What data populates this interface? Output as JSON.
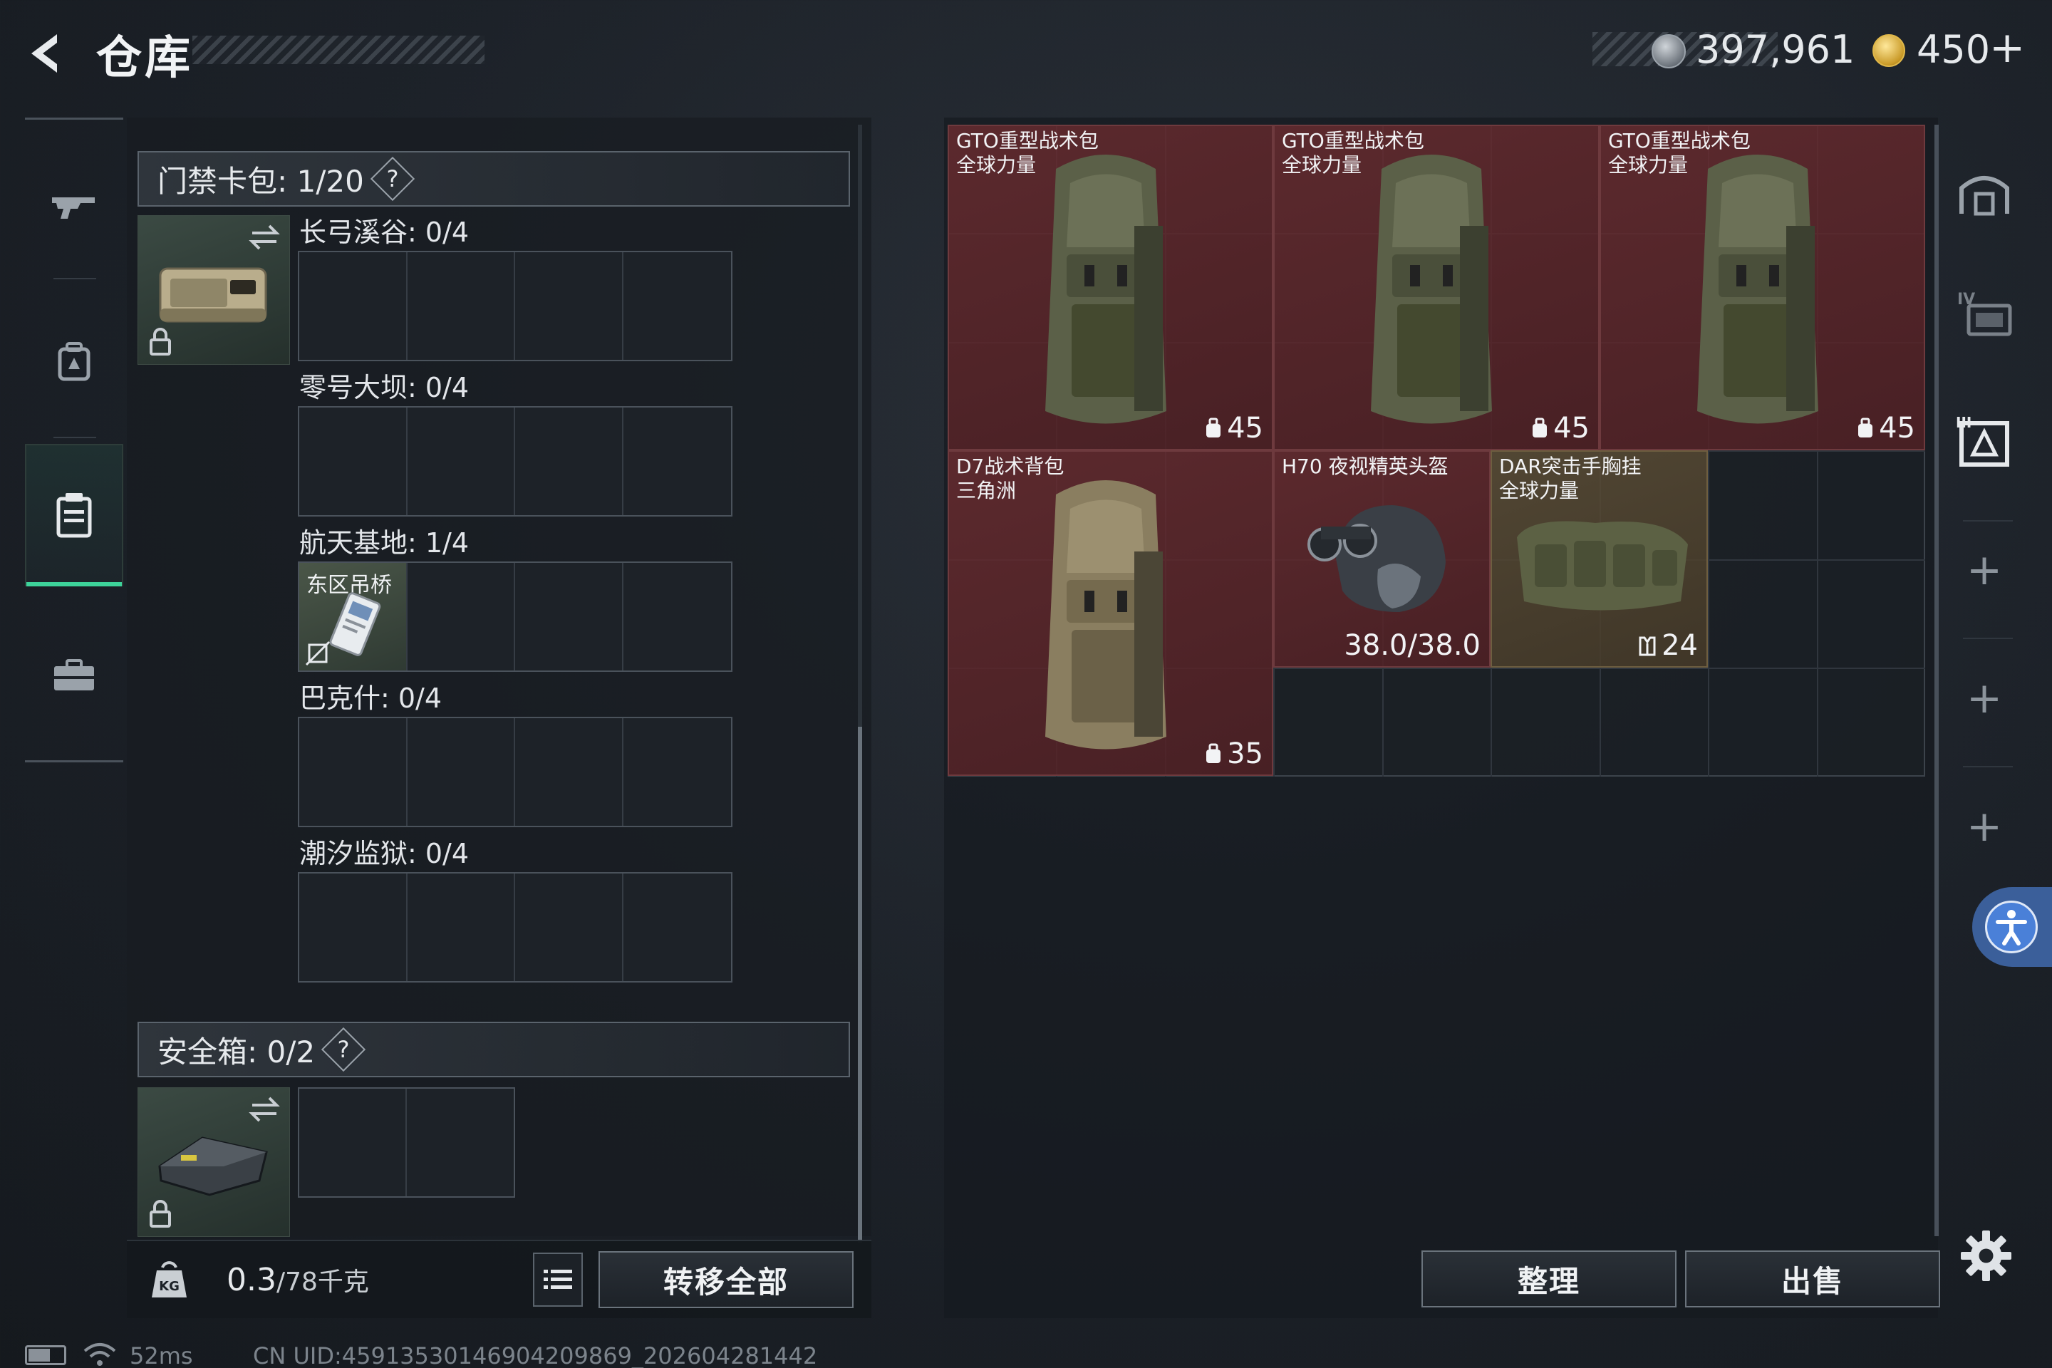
{
  "header": {
    "title": "仓库",
    "currency": {
      "silver": "397,961",
      "gold": "450",
      "gold_plus": "+"
    }
  },
  "left_nav": {
    "items": [
      {
        "icon": "rifle-icon"
      },
      {
        "icon": "backpack-icon"
      },
      {
        "icon": "keycard-case-icon",
        "active": true
      },
      {
        "icon": "toolbox-icon"
      }
    ]
  },
  "keycard_section": {
    "title": "门禁卡包: 1/20",
    "help": "?",
    "maps": [
      {
        "label": "长弓溪谷: 0/4"
      },
      {
        "label": "零号大坝: 0/4"
      },
      {
        "label": "航天基地: 1/4",
        "card": "东区吊桥"
      },
      {
        "label": "巴克什: 0/4"
      },
      {
        "label": "潮汐监狱: 0/4"
      }
    ]
  },
  "safe_section": {
    "title": "安全箱: 0/2",
    "help": "?"
  },
  "weight": {
    "value": "0.3",
    "capacity": "/78千克"
  },
  "buttons": {
    "transfer_all": "转移全部",
    "sort": "整理",
    "sell": "出售"
  },
  "storage_items": [
    {
      "name_line1": "GTO重型战术包",
      "name_line2": "全球力量",
      "stat": "45"
    },
    {
      "name_line1": "GTO重型战术包",
      "name_line2": "全球力量",
      "stat": "45"
    },
    {
      "name_line1": "GTO重型战术包",
      "name_line2": "全球力量",
      "stat": "45"
    },
    {
      "name_line1": "D7战术背包",
      "name_line2": "三角洲",
      "stat": "35"
    },
    {
      "name_line1": "H70 夜视精英头盔",
      "name_line2": "",
      "stat": "38.0/38.0"
    },
    {
      "name_line1": "DAR突击手胸挂",
      "name_line2": "全球力量",
      "stat": "24"
    }
  ],
  "right_nav": {
    "plus": "+"
  },
  "status": {
    "ping": "52ms",
    "uid": "CN UID:4591353014690420986​9_202604281442"
  },
  "colors": {
    "accent_green": "#3dd39a",
    "item_red": "#6e2c30",
    "item_tan": "#5f5037",
    "access_blue": "#4a80d8"
  }
}
